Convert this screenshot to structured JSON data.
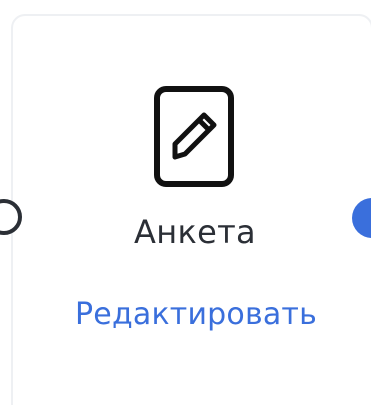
{
  "node": {
    "icon": "edit-document-icon",
    "title": "Анкета",
    "action_label": "Редактировать"
  },
  "ports": {
    "input_icon": "input-port-icon",
    "output_icon": "output-port-icon"
  },
  "colors": {
    "accent": "#3a6fdc",
    "text": "#2b2f36",
    "border": "#eef0f3"
  }
}
